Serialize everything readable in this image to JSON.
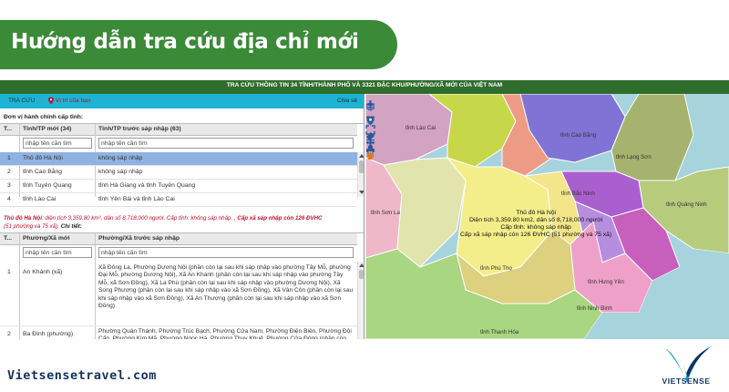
{
  "banner": {
    "title": "Hướng dẫn tra cứu  địa chỉ mới"
  },
  "app": {
    "top_title": "TRA CỨU THÔNG TIN 34 TỈNH/THÀNH PHỐ VÀ 3321 ĐẶC KHU/PHƯỜNG/XÃ MỚI CỦA VIỆT NAM",
    "tabs": {
      "lookup": "TRA CỨU",
      "location": "Vị trí của bạn",
      "share": "Chia sẻ"
    },
    "province_section": {
      "label": "Đơn vị hành chính cấp tỉnh:",
      "headers": {
        "num": "T...",
        "new": "Tỉnh/TP mới (34)",
        "old": "Tỉnh/TP trước sáp nhập (63)"
      },
      "filter_new": "nhập tên cần tìm",
      "filter_old": "nhập tên cần tìm",
      "rows": [
        {
          "num": "1",
          "new": "Thủ đô Hà Nội",
          "old": "không sáp nhập"
        },
        {
          "num": "2",
          "new": "tỉnh Cao Bằng",
          "old": "không sáp nhập"
        },
        {
          "num": "3",
          "new": "tỉnh Tuyên Quang",
          "old": "tỉnh Hà Giang và tỉnh Tuyên Quang"
        },
        {
          "num": "4",
          "new": "tỉnh Lào Cai",
          "old": "tỉnh Yên Bái và tỉnh Lào Cai"
        }
      ]
    },
    "info": {
      "name": "Thủ đô Hà Nội",
      "area": ": diện tích 3,359.80 km², dân số 8,718,000 người. Cấp tỉnh: không sáp nhập. ,",
      "merge": " Cấp xã sáp nhập còn 126 ĐVHC",
      "detail": "(51 phường và 75 xã).",
      "detail_link": " Chi tiết:"
    },
    "ward_section": {
      "headers": {
        "num": "T...",
        "new": "Phường/Xã mới",
        "old": "Phường/Xã trước sáp nhập"
      },
      "filter_new": "nhập tên cần tìm",
      "filter_old": "nhập tên cần tìm",
      "rows": [
        {
          "num": "1",
          "new": "An Khánh (xã)",
          "old": "Xã Đông La, Phường Dương Nội (phần còn lại sau khi sáp nhập vào phường Tây Mỗ, phường Đại Mỗ, phường Dương Nội), Xã An Khánh (phần còn lại sau khi sáp nhập vào phường Tây Mỗ, xã Sơn Đồng), Xã La Phù (phần còn lại sau khi sáp nhập vào phường Dương Nội), Xã Song Phương (phần còn lại sau khi sáp nhập vào xã Sơn Đồng), Xã Vân Côn (phần còn lại sau khi sáp nhập vào xã Sơn Đồng), Xã An Thượng (phần còn lại sau khi sáp nhập vào xã Sơn Đồng)"
        },
        {
          "num": "2",
          "new": "Ba Đình (phường)",
          "old": "Phường Quán Thánh, Phường Trúc Bạch, Phường Cửa Nam, Phường Điện Biên, Phường Đội Cấn, Phường Kim Mã, Phường Ngọc Hà, Phường Thụy Khuê, Phường Cửa Đông (phần còn lại sau khi sáp nhập vào phường Hoàn Kiếm), Phường Đồng Xuân (phần còn"
        }
      ]
    }
  },
  "map": {
    "labels": {
      "lao_cai": "tỉnh Lào Cai",
      "cao_bang": "tỉnh Cao Bằng",
      "lang_son": "tỉnh Lạng Sơn",
      "bac_ninh": "tỉnh Bắc Ninh",
      "quang_ninh": "tỉnh Quảng Ninh",
      "son_la": "tỉnh Sơn La",
      "phu_tho": "tỉnh Phú Thọ",
      "hung_yen": "tỉnh Hưng Yên",
      "ninh_binh": "tỉnh Ninh Bình",
      "thanh_hoa": "tỉnh Thanh Hóa"
    },
    "popup": {
      "line1": "Thủ đô Hà Nội",
      "line2": "Diện tích 3,359.80 km2, dân số 8,718,000 người",
      "line3": "Cấp tỉnh: không sáp nhập",
      "line4": "Cấp xã sáp nhập còn 126 ĐVHC (51 phường và 75 xã)"
    },
    "tools": [
      "layers-icon",
      "location-pin-icon",
      "eraser-icon",
      "print-icon"
    ],
    "controls": [
      "zoom-in-icon",
      "zoom-out-icon",
      "fullscreen-icon",
      "pan-icon",
      "hand-icon"
    ]
  },
  "footer": {
    "url": "Vietsensetravel.com",
    "brand": "VIETSENSE"
  },
  "colors": {
    "banner": "#3a8a38",
    "topbar": "#2f6d2d",
    "tabs": "#1fb3d3",
    "selected_row": "#8fb2e2",
    "info_red": "#c0102a",
    "brand_navy": "#14325e"
  }
}
